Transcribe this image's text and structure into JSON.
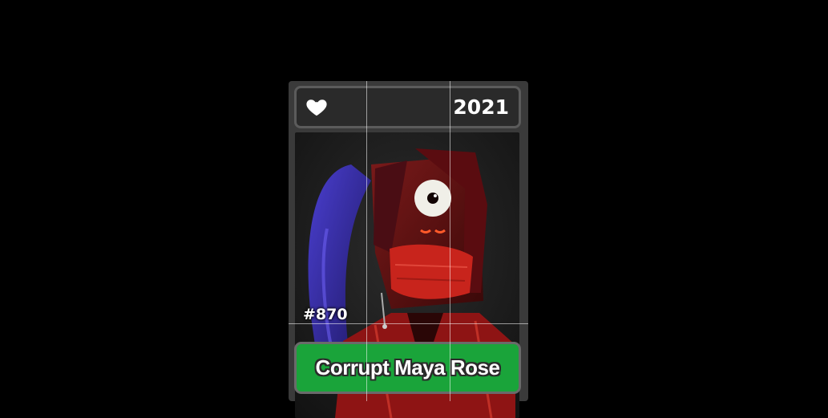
{
  "card": {
    "year": "2021",
    "number": "#870",
    "name": "Corrupt Maya Rose",
    "favorite_icon": "heart-icon",
    "colors": {
      "card_bg": "#3a3a3a",
      "name_button": "#1aa43a",
      "art_bg": "#1c1c1c",
      "accent_red": "#d8231a",
      "hair_blue": "#3a2ea8"
    }
  }
}
